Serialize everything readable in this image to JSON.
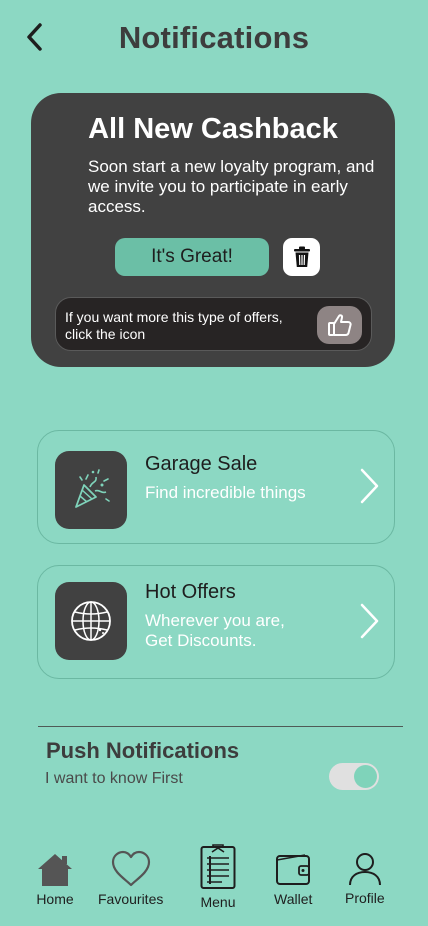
{
  "header": {
    "title": "Notifications",
    "back_icon": "chevron-left-icon"
  },
  "promo": {
    "title": "All New Cashback",
    "description": "Soon start a new loyalty program, and we invite you to participate in early access.",
    "primary_label": "It's Great!",
    "offer_text": "If you want more this type of offers, click the icon",
    "delete_icon": "trash-icon",
    "like_icon": "thumbs-up-icon"
  },
  "cards": [
    {
      "title": "Garage Sale",
      "subtitle": "Find incredible things",
      "icon": "party-popper-icon"
    },
    {
      "title": "Hot Offers",
      "subtitle": "Wherever you are, Get Discounts.",
      "icon": "globe-icon"
    }
  ],
  "push": {
    "title": "Push Notifications",
    "subtitle": "I want to know First",
    "enabled": true
  },
  "nav": [
    {
      "label": "Home",
      "icon": "home-icon"
    },
    {
      "label": "Favourites",
      "icon": "heart-icon"
    },
    {
      "label": "Menu",
      "icon": "menu-clipboard-icon"
    },
    {
      "label": "Wallet",
      "icon": "wallet-icon"
    },
    {
      "label": "Profile",
      "icon": "user-icon"
    }
  ],
  "colors": {
    "background": "#8cd8c3",
    "card_dark": "#414141",
    "accent": "#6bbfa6",
    "text_dark": "#3d3d3d"
  }
}
